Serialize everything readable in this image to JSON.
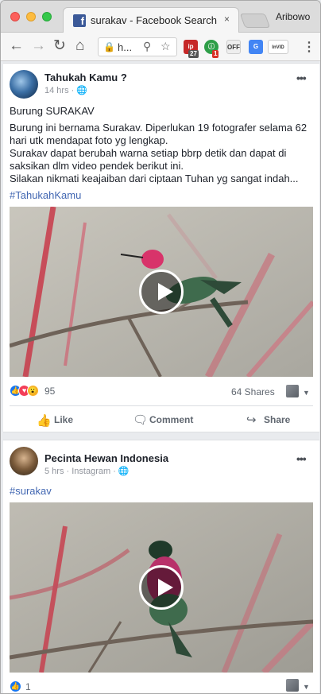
{
  "browser": {
    "tab_title": "surakav - Facebook Search",
    "tab_close": "×",
    "profile": "Aribowo",
    "url": "h...",
    "ext_badge_1": "27",
    "ext_badge_2": "1",
    "ext_off": "OFF",
    "ext_invid": "InVID",
    "icons": [
      "back-arrow-icon",
      "forward-arrow-icon",
      "reload-icon",
      "home-icon",
      "lock-icon",
      "zoom-icon",
      "star-icon",
      "menu-dots-icon"
    ]
  },
  "posts": [
    {
      "author": "Tahukah Kamu ?",
      "meta": "14 hrs · ",
      "title": "Burung SURAKAV",
      "text_lines": [
        "Burung ini bernama Surakav. Diperlukan 19 fotografer selama 62",
        "hari utk mendapat foto yg lengkap.",
        "Surakav dapat berubah warna setiap bbrp detik dan dapat di",
        "saksikan dlm video pendek berikut ini.",
        "Silakan nikmati keajaiban dari ciptaan Tuhan yg sangat indah..."
      ],
      "hashtag": "#TahukahKamu",
      "reaction_count": "95",
      "shares": "64 Shares",
      "actions": {
        "like": "Like",
        "comment": "Comment",
        "share": "Share"
      }
    },
    {
      "author": "Pecinta Hewan Indonesia",
      "meta": "5 hrs · Instagram · ",
      "hashtag": "#surakav",
      "reaction_count": "1"
    }
  ],
  "colors": {
    "facebook_blue": "#3b5998",
    "link": "#4267b2",
    "feed_bg": "#e9ebee"
  }
}
